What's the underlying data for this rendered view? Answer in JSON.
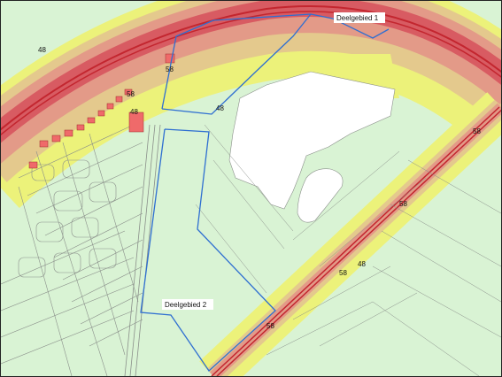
{
  "map": {
    "areas": [
      {
        "label": "Deelgebied 1"
      },
      {
        "label": "Deelgebied 2"
      }
    ],
    "contour_values": [
      "48",
      "58",
      "48",
      "48",
      "58",
      "58",
      "58",
      "58",
      "58",
      "48"
    ],
    "colors": {
      "base_green": "#d9f3d4",
      "contour_yellow": "#ecf27a",
      "contour_tan": "#e4c98d",
      "contour_salmon": "#e39a88",
      "contour_red": "#d85b62",
      "road_red": "#c3262f",
      "building_red": "#ef6a6a",
      "cleared_white": "#ffffff",
      "boundary_blue": "#2f6fd1",
      "line_grey": "#8a8f8a"
    }
  }
}
